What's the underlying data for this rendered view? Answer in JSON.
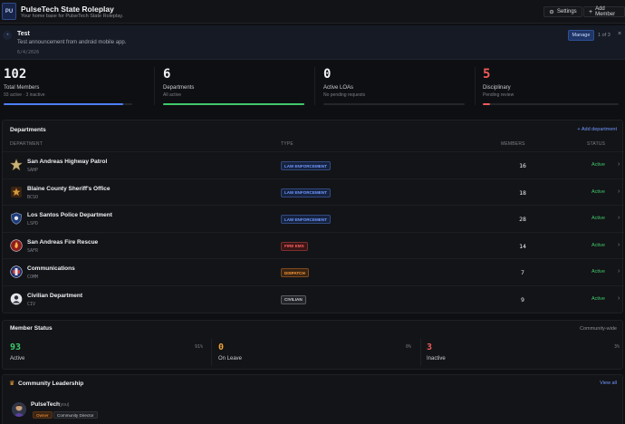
{
  "header": {
    "logo_text": "PU",
    "title": "PulseTech State Roleplay",
    "subtitle": "Your home base for PulseTech State Roleplay.",
    "settings_label": "Settings",
    "add_member_label": "Add Member"
  },
  "announcement": {
    "title": "Test",
    "body": "Test announcement from android mobile app.",
    "date": "6/4/2026",
    "manage_label": "Manage",
    "pager": "1 of 3"
  },
  "stats": [
    {
      "value": "102",
      "label": "Total Members",
      "sub": "93 active · 3 inactive",
      "color": "#4d7fff",
      "fill": 0.93
    },
    {
      "value": "6",
      "label": "Departments",
      "sub": "All active",
      "color": "#3fc96b",
      "fill": 1.0
    },
    {
      "value": "0",
      "label": "Active LOAs",
      "sub": "No pending requests",
      "color": "#3a3d44",
      "fill": 0.0
    },
    {
      "value": "5",
      "label": "Disciplinary",
      "sub": "Pending review",
      "color": "#ef5a5a",
      "fill": 0.05
    }
  ],
  "departments": {
    "title": "Departments",
    "add_label": "+ Add department",
    "columns": {
      "department": "DEPARTMENT",
      "type": "TYPE",
      "members": "MEMBERS",
      "status": "STATUS"
    },
    "rows": [
      {
        "name": "San Andreas Highway Patrol",
        "code": "SAHP",
        "type": "LAW ENFORCEMENT",
        "type_kind": "law",
        "members": "16",
        "status": "Active",
        "icon": "star-badge-icon"
      },
      {
        "name": "Blaine County Sheriff's Office",
        "code": "BCSO",
        "type": "LAW ENFORCEMENT",
        "type_kind": "law",
        "members": "18",
        "status": "Active",
        "icon": "sheriff-badge-icon"
      },
      {
        "name": "Los Santos Police Department",
        "code": "LSPD",
        "type": "LAW ENFORCEMENT",
        "type_kind": "law",
        "members": "28",
        "status": "Active",
        "icon": "police-badge-icon"
      },
      {
        "name": "San Andreas Fire Rescue",
        "code": "SAFR",
        "type": "FIRE EMS",
        "type_kind": "fire",
        "members": "14",
        "status": "Active",
        "icon": "fire-badge-icon"
      },
      {
        "name": "Communications",
        "code": "COMM",
        "type": "DISPATCH",
        "type_kind": "dispatch",
        "members": "7",
        "status": "Active",
        "icon": "comm-badge-icon"
      },
      {
        "name": "Civilian Department",
        "code": "CIV",
        "type": "CIVILIAN",
        "type_kind": "civ",
        "members": "9",
        "status": "Active",
        "icon": "civilian-badge-icon"
      }
    ]
  },
  "member_status": {
    "title": "Member Status",
    "scope": "Community-wide",
    "items": [
      {
        "value": "93",
        "label": "Active",
        "pct": "91%",
        "color": "#3fc96b"
      },
      {
        "value": "0",
        "label": "On Leave",
        "pct": "0%",
        "color": "#f0a23a"
      },
      {
        "value": "3",
        "label": "Inactive",
        "pct": "3%",
        "color": "#ef5a5a"
      }
    ]
  },
  "leadership": {
    "title": "Community Leadership",
    "view_all": "View all",
    "leader": {
      "name": "PulseTech",
      "you": "(you)",
      "role_badge": "Owner",
      "title_badge": "Community Director"
    }
  },
  "colors": {
    "law_bg": "#16233f",
    "law_fg": "#6f97ff",
    "fire_bg": "#3a1616",
    "fire_fg": "#ff5f5f",
    "dispatch_bg": "#3a2412",
    "dispatch_fg": "#ff9a3c",
    "civ_bg": "#23252a",
    "civ_fg": "#c9ccd2"
  }
}
